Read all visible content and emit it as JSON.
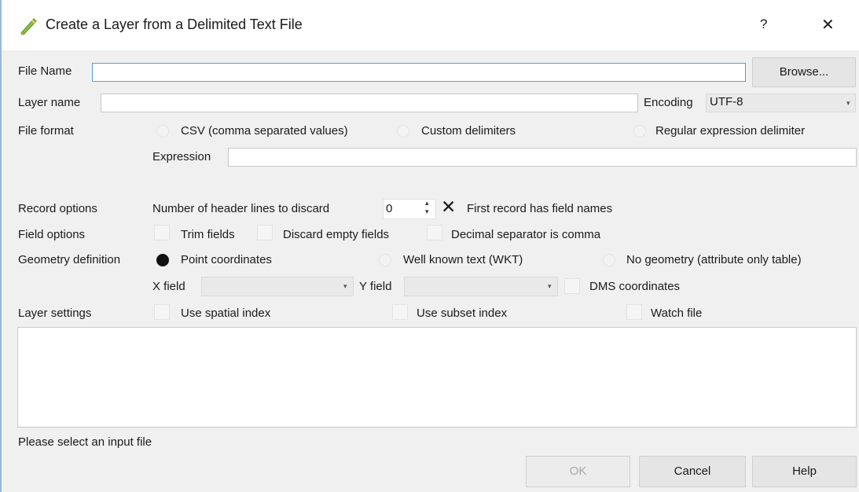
{
  "window": {
    "title": "Create a Layer from a Delimited Text File",
    "help_glyph": "?",
    "close_glyph": "✕",
    "app_icon": "qgis-pencil-icon"
  },
  "file": {
    "label": "File Name",
    "value": "",
    "browse_label": "Browse..."
  },
  "layer": {
    "label": "Layer name",
    "value": "",
    "encoding_label": "Encoding",
    "encoding_value": "UTF-8"
  },
  "format": {
    "label": "File format",
    "options": [
      "CSV (comma separated values)",
      "Custom delimiters",
      "Regular expression delimiter"
    ],
    "selected": "",
    "expression_label": "Expression",
    "expression_value": ""
  },
  "records": {
    "label": "Record options",
    "header_lines_label": "Number of header lines to discard",
    "header_lines_value": "0",
    "first_record_label": "First record has field names",
    "first_record_checked": true
  },
  "fields": {
    "label": "Field options",
    "trim_label": "Trim fields",
    "discard_label": "Discard empty fields",
    "decimal_label": "Decimal separator is comma"
  },
  "geometry": {
    "label": "Geometry definition",
    "options": [
      "Point coordinates",
      "Well known text (WKT)",
      "No geometry (attribute only table)"
    ],
    "selected": "Point coordinates",
    "x_label": "X field",
    "y_label": "Y field",
    "x_value": "",
    "y_value": "",
    "dms_label": "DMS coordinates"
  },
  "settings": {
    "label": "Layer settings",
    "spatial_label": "Use spatial index",
    "subset_label": "Use subset index",
    "watch_label": "Watch file"
  },
  "status": {
    "text": "Please select an input file"
  },
  "buttons": {
    "ok": "OK",
    "cancel": "Cancel",
    "help": "Help"
  },
  "colors": {
    "focus_border": "#5b9bd5",
    "title_bg": "#ffffff",
    "dialog_bg": "#f0f0f0"
  }
}
